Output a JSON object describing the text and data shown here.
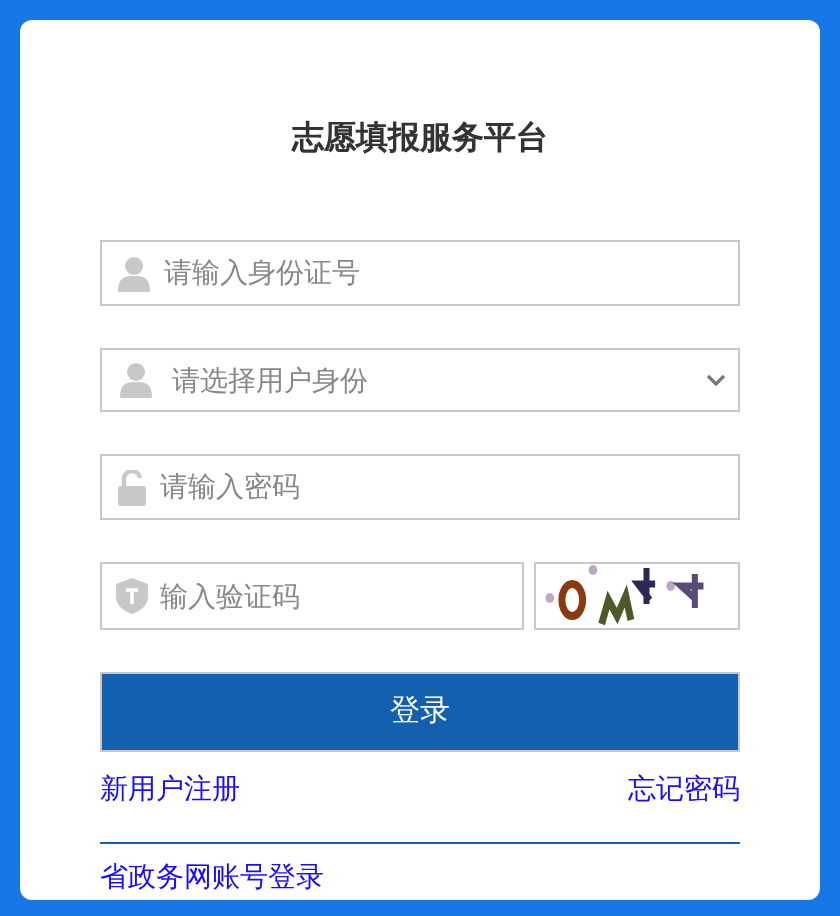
{
  "title": "志愿填报服务平台",
  "fields": [
    {
      "kind": "text",
      "placeholder": "请输入身份证号"
    },
    {
      "kind": "select",
      "placeholder": "请选择用户身份"
    },
    {
      "kind": "password",
      "placeholder": "请输入密码"
    }
  ],
  "captcha": {
    "placeholder": "输入验证码"
  },
  "login_button": "登录",
  "links": {
    "register": "新用户注册",
    "forgot": "忘记密码",
    "gov_login": "省政务网账号登录"
  }
}
